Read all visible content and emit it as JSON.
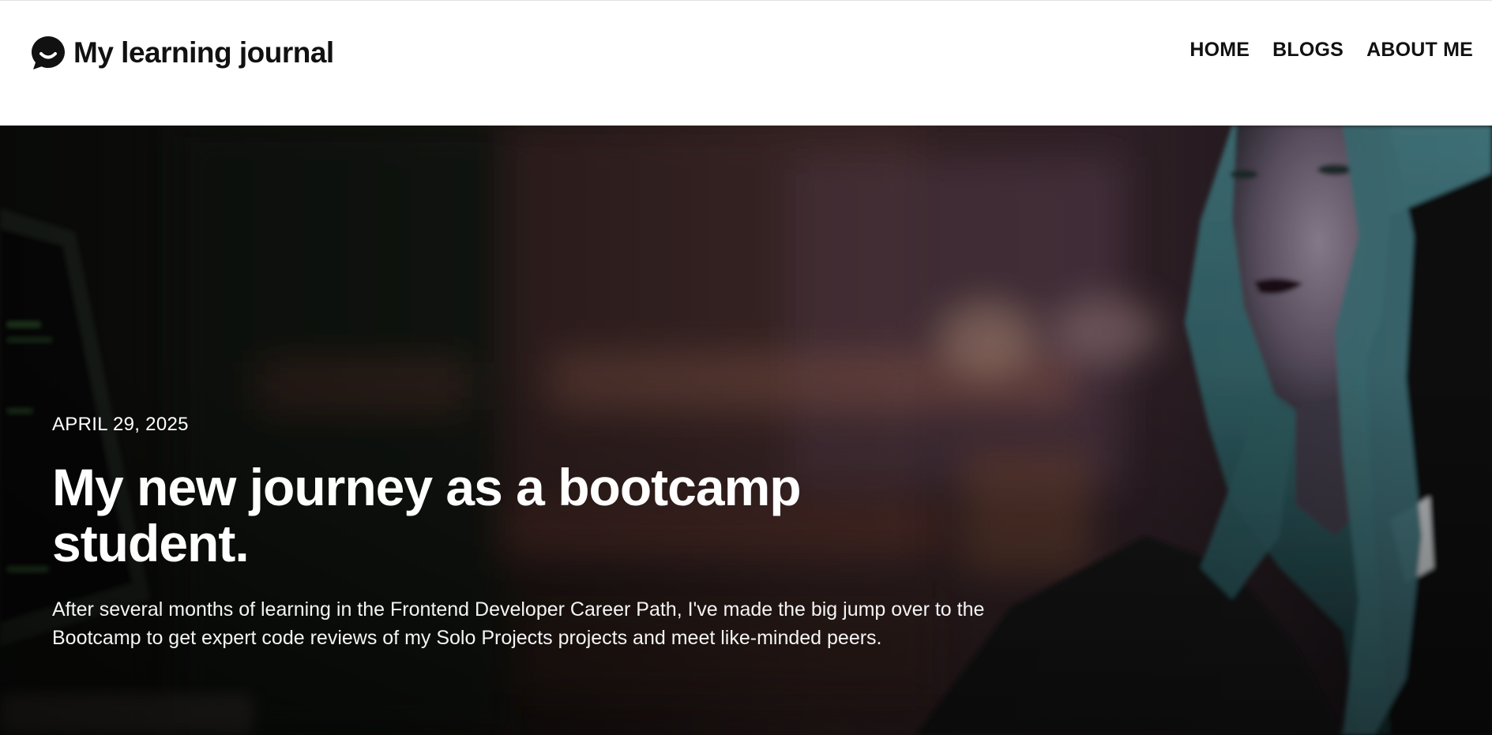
{
  "header": {
    "site_title": "My learning journal",
    "logo_icon": "chat-bubble-smile-icon",
    "nav": [
      {
        "label": "HOME"
      },
      {
        "label": "BLOGS"
      },
      {
        "label": "ABOUT ME"
      }
    ]
  },
  "hero": {
    "date": "APRIL 29, 2025",
    "title": "My new journey as a bootcamp student.",
    "description": "After several months of learning in the Frontend Developer Career Path, I've made the big jump over to the Bootcamp to get expert code reviews of my Solo Projects projects and meet like-minded peers.",
    "background_image": "woman-with-teal-hair-at-computer-photo"
  },
  "colors": {
    "text_dark": "#111111",
    "hero_text": "#ffffff",
    "hero_bg": "#15110f"
  }
}
